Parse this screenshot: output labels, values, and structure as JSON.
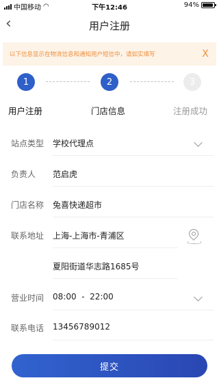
{
  "status_bar": {
    "carrier": "中国移动",
    "time": "下午12:46",
    "battery": "94%",
    "battery_level": 0.94
  },
  "nav": {
    "back_icon": "chevron-left-icon",
    "title": "用户注册"
  },
  "notice": {
    "text": "以下信息显示在物流信息和通知用户短信中，请如实填写",
    "close_label": "X",
    "color": "#ef8f3b",
    "background": "#fdf3e7"
  },
  "steps": {
    "active_color": "#2f5fc8",
    "items": [
      {
        "number": "1",
        "label": "用户注册",
        "state": "done"
      },
      {
        "number": "2",
        "label": "门店信息",
        "state": "done"
      },
      {
        "number": "3",
        "label": "注册成功",
        "state": "todo"
      }
    ]
  },
  "form": {
    "site_type": {
      "label": "站点类型",
      "value": "学校代理点"
    },
    "manager": {
      "label": "负责人",
      "value": "范启虎"
    },
    "store_name": {
      "label": "门店名称",
      "value": "兔喜快递超市"
    },
    "address": {
      "label": "联系地址",
      "region": "上海-上海市-青浦区",
      "detail": "夏阳街道华志路1685号"
    },
    "hours": {
      "label": "营业时间",
      "value": "08:00  -  22:00"
    },
    "phone": {
      "label": "联系电话",
      "value": "13456789012"
    }
  },
  "submit_label": "提交"
}
